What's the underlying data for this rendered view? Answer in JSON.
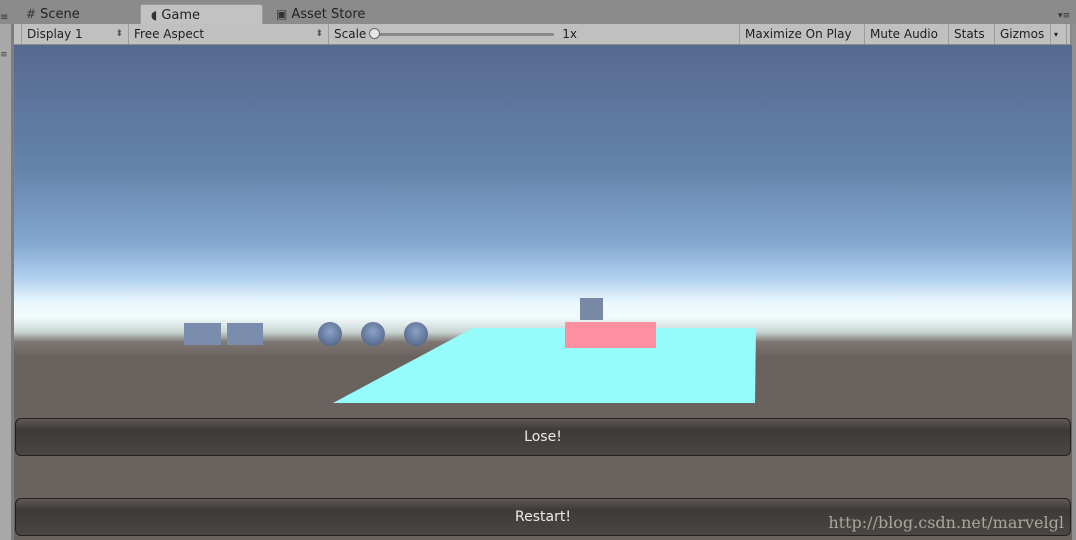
{
  "tabs": [
    {
      "label": "Scene",
      "icon": "grid-icon",
      "active": false
    },
    {
      "label": "Game",
      "icon": "pacman-icon",
      "active": true
    },
    {
      "label": "Asset Store",
      "icon": "bag-icon",
      "active": false
    }
  ],
  "toolbar": {
    "display": "Display 1",
    "aspect": "Free Aspect",
    "scale_label": "Scale",
    "scale_value": "1x",
    "scale_fraction": 0.0,
    "maximize": "Maximize On Play",
    "mute": "Mute Audio",
    "stats": "Stats",
    "gizmos": "Gizmos"
  },
  "game_ui": {
    "lose_button": "Lose!",
    "restart_button": "Restart!"
  },
  "colors": {
    "platform": "#96fbfb",
    "pink_block": "#ff8fa0",
    "grey_cube": "#7889a6"
  },
  "watermark": "http://blog.csdn.net/marvelgl"
}
